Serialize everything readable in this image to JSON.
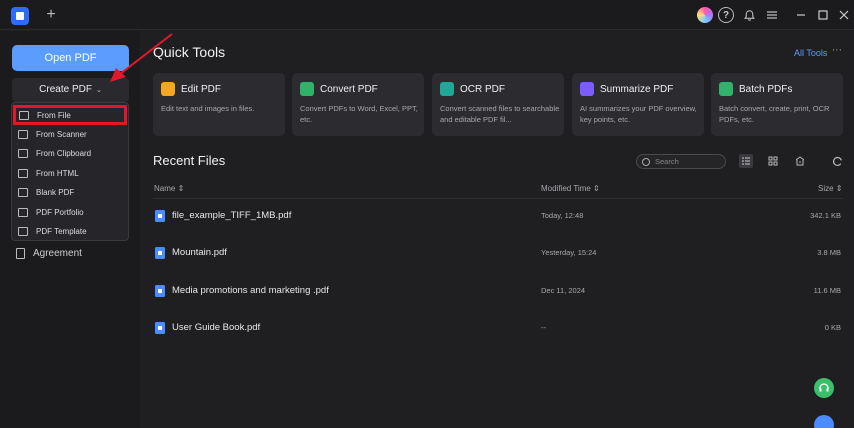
{
  "titlebar": {
    "new_tab_symbol": "+",
    "help_symbol": "?",
    "minimize_symbol": "—",
    "maximize_symbol": "☐",
    "close_symbol": "✕"
  },
  "sidebar": {
    "open_pdf": "Open PDF",
    "create_pdf": "Create PDF",
    "create_chevron": "⌄",
    "dropdown_items": [
      {
        "label": "From File",
        "icon": "folder-icon"
      },
      {
        "label": "From Scanner",
        "icon": "scanner-icon"
      },
      {
        "label": "From Clipboard",
        "icon": "clipboard-icon"
      },
      {
        "label": "From HTML",
        "icon": "html-icon"
      },
      {
        "label": "Blank PDF",
        "icon": "blank-page-icon"
      },
      {
        "label": "PDF Portfolio",
        "icon": "portfolio-icon"
      },
      {
        "label": "PDF Template",
        "icon": "template-icon"
      }
    ],
    "agreement": "Agreement"
  },
  "quick_tools": {
    "title": "Quick Tools",
    "all_tools": "All Tools",
    "more": "⋯",
    "cards": [
      {
        "title": "Edit PDF",
        "desc": "Edit text and images in files.",
        "color": "#f5a623"
      },
      {
        "title": "Convert PDF",
        "desc": "Convert PDFs to Word, Excel, PPT, etc.",
        "color": "#2fb36b"
      },
      {
        "title": "OCR PDF",
        "desc": "Convert scanned files to searchable and editable PDF fil...",
        "color": "#1fa89a"
      },
      {
        "title": "Summarize PDF",
        "desc": "AI summarizes your PDF overview, key points, etc.",
        "color": "#7a5cff"
      },
      {
        "title": "Batch PDFs",
        "desc": "Batch convert, create, print, OCR PDFs, etc.",
        "color": "#2fb36b"
      }
    ]
  },
  "recent": {
    "title": "Recent Files",
    "search_placeholder": "Search",
    "columns": {
      "name": "Name",
      "modified": "Modified Time",
      "size": "Size",
      "sort": "⇕"
    },
    "files": [
      {
        "name": "file_example_TIFF_1MB.pdf",
        "modified": "Today, 12:48",
        "size": "342.1 KB"
      },
      {
        "name": "Mountain.pdf",
        "modified": "Yesterday, 15:24",
        "size": "3.8 MB"
      },
      {
        "name": "Media promotions and marketing .pdf",
        "modified": "Dec 11, 2024",
        "size": "11.6 MB"
      },
      {
        "name": "User Guide Book.pdf",
        "modified": "--",
        "size": "0 KB"
      }
    ]
  },
  "colors": {
    "accent": "#5b9dff",
    "highlight_box": "#e2182a",
    "annotation_arrow": "#e2182a"
  }
}
